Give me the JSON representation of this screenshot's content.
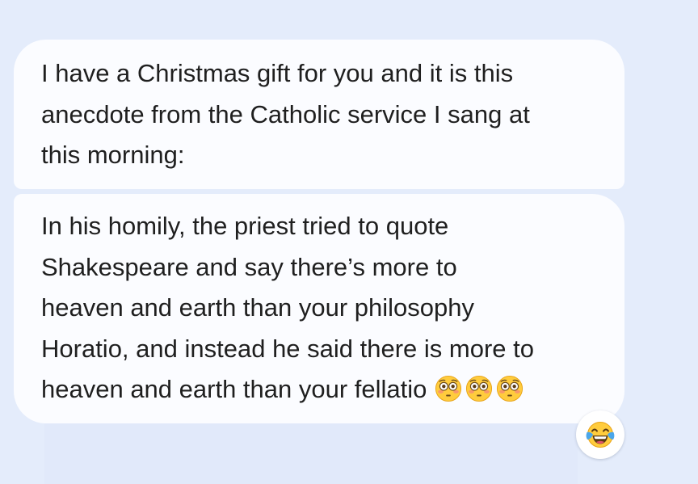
{
  "messages": [
    {
      "lines": [
        "I have a Christmas gift for you and it is this",
        "anecdote from the Catholic service I sang at",
        "this morning:"
      ]
    },
    {
      "lines": [
        "In his homily, the priest tried to quote",
        "Shakespeare and say there’s more to",
        "heaven and earth than your philosophy",
        "Horatio, and instead he said there is more to",
        "heaven and earth than your fellatio"
      ],
      "trailing_emoji": [
        "flushed-face",
        "flushed-face",
        "flushed-face"
      ],
      "reaction": "face-with-tears-of-joy"
    }
  ],
  "colors": {
    "background": "#e4ecfb",
    "bubble": "#fbfcff",
    "text": "#1f1f1f"
  }
}
